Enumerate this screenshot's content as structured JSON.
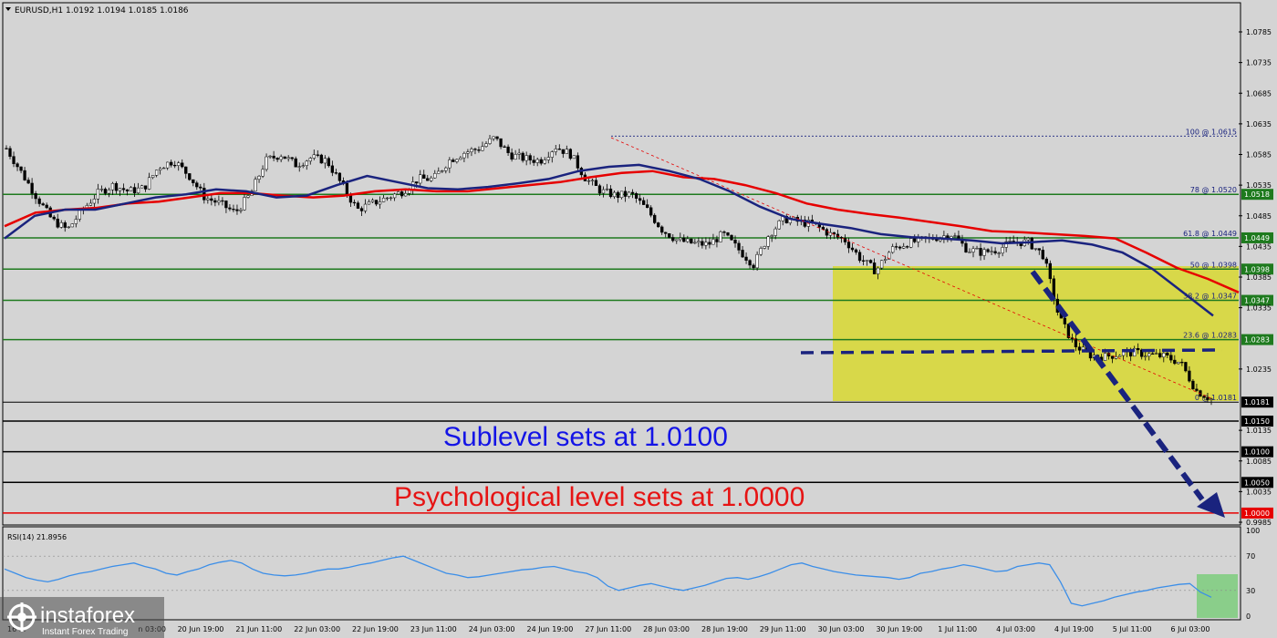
{
  "header": {
    "text": "EURUSD,H1  1.0192 1.0194 1.0185 1.0186"
  },
  "annotations": {
    "sublevel": "Sublevel sets at 1.0100",
    "psych": "Psychological level sets at 1.0000"
  },
  "colors": {
    "background": "#d4d4d4",
    "candle": "#000000",
    "ma_fast": "#1a237e",
    "ma_slow": "#e60000",
    "fib_line": "#1e7a1e",
    "fib_zone": "#d8d83a",
    "sublevel_text": "#1414e6",
    "psych_text": "#e61414",
    "arrow": "#1a237e",
    "rsi_line": "#3b8ee8"
  },
  "chart_data": {
    "type": "candlestick",
    "symbol": "EURUSD",
    "timeframe": "H1",
    "header_ohlc": {
      "open": 1.0192,
      "high": 1.0194,
      "low": 1.0185,
      "close": 1.0186
    },
    "price_axis_ticks": [
      "1.0785",
      "1.0735",
      "1.0685",
      "1.0635",
      "1.0585",
      "1.0535",
      "1.0485",
      "1.0435",
      "1.0385",
      "1.0335",
      "1.0235",
      "1.0135",
      "1.0085",
      "1.0035",
      "0.9985"
    ],
    "y_range": [
      0.998,
      1.081
    ],
    "time_axis_labels": [
      "20 Jun 19:00",
      "21 Jun 11:00",
      "22 Jun 03:00",
      "22 Jun 19:00",
      "23 Jun 11:00",
      "24 Jun 03:00",
      "24 Jun 19:00",
      "27 Jun 11:00",
      "28 Jun 03:00",
      "28 Jun 19:00",
      "29 Jun 11:00",
      "30 Jun 03:00",
      "30 Jun 19:00",
      "1 Jul 11:00",
      "4 Jul 03:00",
      "4 Jul 19:00",
      "5 Jul 11:00",
      "6 Jul 03:00"
    ],
    "time_axis_partial": [
      "16 ...",
      "n 03:00"
    ],
    "close_path": [
      1.0595,
      1.0555,
      1.0515,
      1.0478,
      1.0462,
      1.0495,
      1.0522,
      1.0535,
      1.0525,
      1.053,
      1.0565,
      1.0575,
      1.055,
      1.0515,
      1.0505,
      1.049,
      1.052,
      1.0575,
      1.0585,
      1.0568,
      1.058,
      1.0575,
      1.0535,
      1.0495,
      1.0505,
      1.0515,
      1.0525,
      1.0545,
      1.0545,
      1.0575,
      1.0588,
      1.0595,
      1.0612,
      1.0585,
      1.0578,
      1.0575,
      1.0598,
      1.0585,
      1.0545,
      1.0525,
      1.0518,
      1.052,
      1.0495,
      1.0462,
      1.0445,
      1.044,
      1.0438,
      1.0455,
      1.043,
      1.0405,
      1.0455,
      1.048,
      1.0475,
      1.047,
      1.0455,
      1.0445,
      1.0415,
      1.0395,
      1.043,
      1.044,
      1.0445,
      1.045,
      1.0455,
      1.043,
      1.0425,
      1.043,
      1.0442,
      1.0442,
      1.042,
      1.032,
      1.0275,
      1.0258,
      1.0255,
      1.026,
      1.0262,
      1.0258,
      1.0255,
      1.0245,
      1.02,
      1.0186
    ],
    "ma_fast": {
      "name": "",
      "values": [
        1.0448,
        1.0485,
        1.0495,
        1.0495,
        1.0505,
        1.0515,
        1.052,
        1.0528,
        1.0525,
        1.0515,
        1.0518,
        1.0535,
        1.055,
        1.054,
        1.053,
        1.0528,
        1.0532,
        1.0538,
        1.0545,
        1.0558,
        1.0565,
        1.0568,
        1.0558,
        1.0545,
        1.0525,
        1.05,
        1.048,
        1.0472,
        1.0465,
        1.0455,
        1.045,
        1.0448,
        1.0445,
        1.044,
        1.0442,
        1.0445,
        1.0438,
        1.0425,
        1.0398,
        1.036,
        1.0322
      ]
    },
    "ma_slow": {
      "name": "",
      "values": [
        1.0468,
        1.049,
        1.0495,
        1.0498,
        1.0505,
        1.0508,
        1.0515,
        1.0522,
        1.0522,
        1.0518,
        1.0515,
        1.0518,
        1.0525,
        1.0528,
        1.0525,
        1.0525,
        1.053,
        1.0535,
        1.054,
        1.0548,
        1.0555,
        1.0558,
        1.0548,
        1.0545,
        1.0535,
        1.0522,
        1.0505,
        1.0495,
        1.0488,
        1.0482,
        1.0475,
        1.0468,
        1.046,
        1.0458,
        1.0455,
        1.0452,
        1.0448,
        1.0425,
        1.04,
        1.0382,
        1.036
      ]
    },
    "fib_levels": [
      {
        "label": "100 @ 1.0615",
        "price": 1.0615
      },
      {
        "label": "78 @ 1.0520",
        "price": 1.052,
        "tag": "1.0518"
      },
      {
        "label": "61.8 @ 1.0449",
        "price": 1.0449,
        "tag": "1.0449"
      },
      {
        "label": "50 @ 1.0398",
        "price": 1.0398,
        "tag": "1.0398"
      },
      {
        "label": "38.2 @ 1.0347",
        "price": 1.0347,
        "tag": "1.0347"
      },
      {
        "label": "23.6 @ 1.0283",
        "price": 1.0283,
        "tag": "1.0283"
      },
      {
        "label": "0 @ 1.0181",
        "price": 1.0181,
        "tag": "1.0181"
      }
    ],
    "horizontal_levels": [
      {
        "price": 1.015,
        "tag": "1.0150"
      },
      {
        "price": 1.01,
        "tag": "1.0100"
      },
      {
        "price": 1.005,
        "tag": "1.0050"
      },
      {
        "price": 1.0,
        "tag": "1.0000"
      }
    ],
    "dashed_level": 1.026,
    "rsi": {
      "label": "RSI(14) 21.8956",
      "ticks": [
        "100",
        "70",
        "30",
        "0"
      ],
      "range": [
        0,
        100
      ],
      "values": [
        55,
        50,
        45,
        42,
        40,
        43,
        47,
        50,
        52,
        55,
        58,
        60,
        62,
        58,
        55,
        50,
        48,
        52,
        55,
        60,
        63,
        65,
        62,
        55,
        50,
        48,
        47,
        48,
        50,
        53,
        55,
        55,
        57,
        60,
        62,
        65,
        68,
        70,
        65,
        60,
        55,
        50,
        48,
        45,
        46,
        48,
        50,
        52,
        54,
        55,
        57,
        58,
        55,
        52,
        50,
        45,
        35,
        30,
        33,
        36,
        38,
        35,
        32,
        30,
        33,
        36,
        40,
        44,
        45,
        43,
        46,
        50,
        55,
        60,
        62,
        58,
        55,
        52,
        50,
        48,
        47,
        46,
        45,
        43,
        45,
        50,
        52,
        55,
        57,
        60,
        58,
        55,
        52,
        53,
        58,
        60,
        62,
        60,
        40,
        15,
        12,
        15,
        18,
        22,
        25,
        28,
        30,
        33,
        35,
        37,
        38,
        28,
        22
      ]
    }
  },
  "watermark": {
    "brand": "instaforex",
    "tagline": "Instant Forex Trading"
  }
}
